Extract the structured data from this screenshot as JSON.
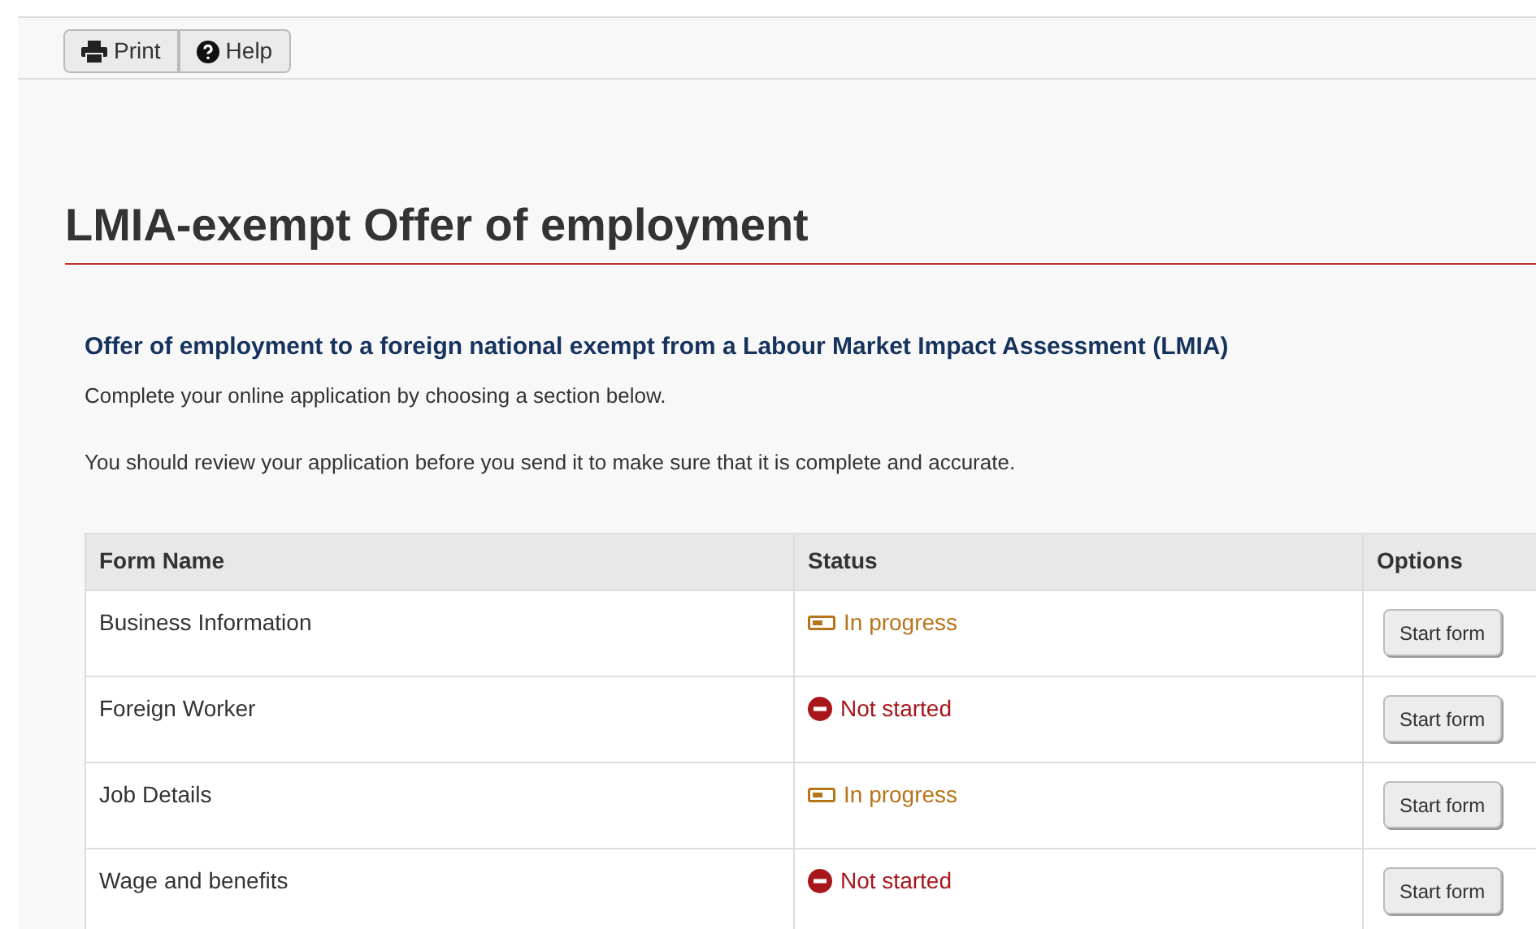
{
  "toolbar": [
    {
      "label": "Print",
      "kind": "print"
    },
    {
      "label": "Help",
      "kind": "help"
    }
  ],
  "title": "LMIA-exempt Offer of employment",
  "subtitle": "Offer of employment to a foreign national exempt from a Labour Market Impact Assessment (LMIA)",
  "paragraphs": [
    "Complete your online application by choosing a section below.",
    "You should review your application before you send it to make sure that it is complete and accurate."
  ],
  "table": {
    "columns": [
      "Form Name",
      "Status",
      "Options"
    ],
    "rows": [
      {
        "name": "Business Information",
        "status": "In progress",
        "kind": "in_progress",
        "action": "Start form"
      },
      {
        "name": "Foreign Worker",
        "status": "Not started",
        "kind": "not_started",
        "action": "Start form"
      },
      {
        "name": "Job Details",
        "status": "In progress",
        "kind": "in_progress",
        "action": "Start form"
      },
      {
        "name": "Wage and benefits",
        "status": "Not started",
        "kind": "not_started",
        "action": "Start form"
      }
    ]
  }
}
